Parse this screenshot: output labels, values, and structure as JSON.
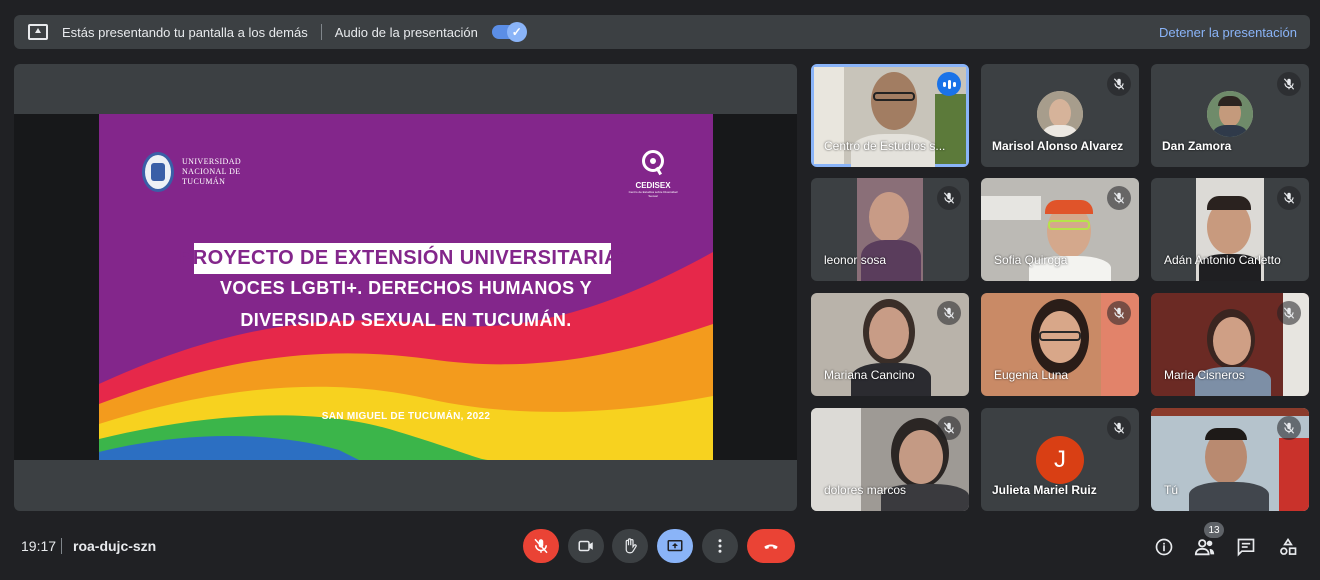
{
  "banner": {
    "presenting_text": "Estás presentando tu pantalla a los demás",
    "audio_label": "Audio de la presentación",
    "audio_enabled": true,
    "stop_label": "Detener la presentación"
  },
  "slide": {
    "university_name": "UNIVERSIDAD NACIONAL DE TUCUMÁN",
    "partner_logo": "CEDISEX",
    "partner_tagline": "Centro de Estudios sobre Diversidad Sexual",
    "title_line1": "PROYECTO DE EXTENSIÓN UNIVERSITARIA:",
    "title_line2": "VOCES LGBTI+. DERECHOS HUMANOS Y",
    "title_line3": "DIVERSIDAD SEXUAL EN TUCUMÁN.",
    "place_date": "SAN MIGUEL DE TUCUMÁN, 2022",
    "colors": {
      "background": "#83268b",
      "red": "#e6284a",
      "orange": "#f39b1d",
      "yellow": "#f7d21f",
      "green": "#3bb54a",
      "blue": "#2c6fc2"
    }
  },
  "participants": [
    {
      "name": "Centro de Estudios s...",
      "state": "speaking"
    },
    {
      "name": "Marisol Alonso Alvarez",
      "state": "muted"
    },
    {
      "name": "Dan Zamora",
      "state": "muted"
    },
    {
      "name": "leonor sosa",
      "state": "muted"
    },
    {
      "name": "Sofia Quiroga",
      "state": "muted"
    },
    {
      "name": "Adán Antonio Carletto",
      "state": "muted"
    },
    {
      "name": "Mariana Cancino",
      "state": "muted"
    },
    {
      "name": "Eugenia Luna",
      "state": "muted"
    },
    {
      "name": "Maria Cisneros",
      "state": "muted"
    },
    {
      "name": "dolores marcos",
      "state": "muted"
    },
    {
      "name": "Julieta Mariel Ruiz",
      "state": "muted",
      "avatar_letter": "J"
    },
    {
      "name": "Tú",
      "state": "muted"
    }
  ],
  "bottom": {
    "time": "19:17",
    "meeting_code": "roa-dujc-szn",
    "participant_count": "13",
    "controls": [
      "mic-off-button",
      "camera-button",
      "raise-hand-button",
      "present-button",
      "more-options-button",
      "leave-call-button"
    ],
    "right_controls": [
      "info-icon",
      "people-icon",
      "chat-icon",
      "activities-icon"
    ],
    "accent": "#8ab4f8",
    "danger": "#ea4335"
  }
}
